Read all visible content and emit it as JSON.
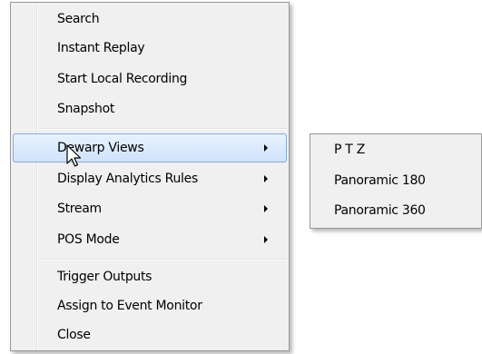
{
  "context_menu": {
    "items": [
      {
        "label": "Search"
      },
      {
        "label": "Instant Replay"
      },
      {
        "label": "Start Local Recording"
      },
      {
        "label": "Snapshot"
      },
      {
        "label": "Dewarp Views",
        "has_submenu": true,
        "highlighted": true
      },
      {
        "label": "Display Analytics Rules",
        "has_submenu": true
      },
      {
        "label": "Stream",
        "has_submenu": true
      },
      {
        "label": "POS Mode",
        "has_submenu": true
      },
      {
        "label": "Trigger Outputs"
      },
      {
        "label": "Assign to Event Monitor"
      },
      {
        "label": "Close"
      }
    ],
    "submenu_icon": "chevron-right-icon"
  },
  "dewarp_submenu": {
    "items": [
      {
        "label": "P T Z"
      },
      {
        "label": "Panoramic 180"
      },
      {
        "label": "Panoramic 360"
      }
    ]
  },
  "cursor_icon": "arrow-cursor-icon",
  "colors": {
    "menu_background": "#f0f0f0",
    "menu_border": "#979797",
    "highlight_border": "#84acdd",
    "highlight_fill": "#cfe3fb"
  }
}
